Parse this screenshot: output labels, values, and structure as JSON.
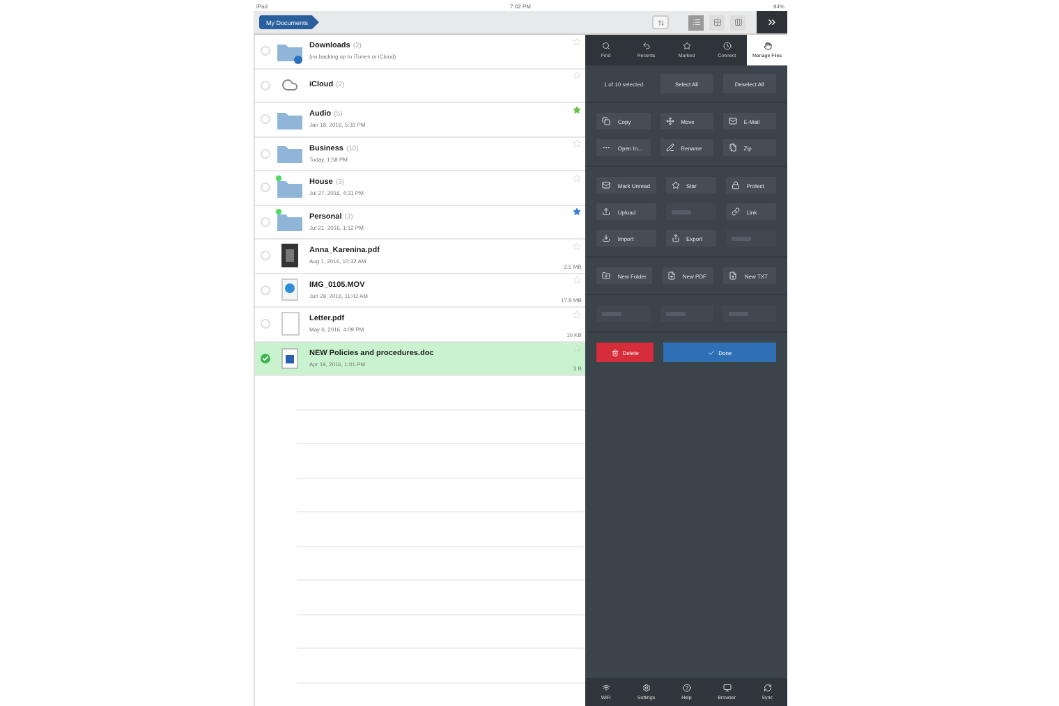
{
  "status_bar": {
    "device": "iPad",
    "time": "7:02 PM",
    "battery": "94%"
  },
  "header": {
    "breadcrumb": "My Documents",
    "views": [
      {
        "kind": "list",
        "selected": true
      },
      {
        "kind": "grid",
        "selected": false
      },
      {
        "kind": "columns",
        "selected": false
      }
    ]
  },
  "files": [
    {
      "kind": "folder",
      "name": "Downloads",
      "count": "(2)",
      "subtitle": "(no backing up to iTunes or iCloud)",
      "badge": true,
      "tagged": false,
      "starred": false,
      "selected": false
    },
    {
      "kind": "cloud",
      "name": "iCloud",
      "count": "(2)",
      "badge": false,
      "tagged": false,
      "starred": false,
      "selected": false
    },
    {
      "kind": "folder",
      "name": "Audio",
      "count": "(5)",
      "subtitle": "Jan 18, 2016, 5:33 PM",
      "badge": false,
      "tagged": false,
      "starred": true,
      "color": "#6cc04a",
      "selected": false
    },
    {
      "kind": "folder",
      "name": "Business",
      "count": "(10)",
      "subtitle": "Today, 1:58 PM",
      "badge": false,
      "tagged": false,
      "starred": false,
      "selected": false
    },
    {
      "kind": "folder",
      "name": "House",
      "count": "(3)",
      "subtitle": "Jul 27, 2016, 4:31 PM",
      "badge": false,
      "tagged": true,
      "starred": false,
      "selected": false
    },
    {
      "kind": "folder",
      "name": "Personal",
      "count": "(3)",
      "subtitle": "Jul 21, 2016, 1:12 PM",
      "badge": false,
      "tagged": true,
      "starred": true,
      "color": "#3b82d6",
      "selected": false
    },
    {
      "kind": "pdf",
      "name": "Anna_Karenina.pdf",
      "subtitle": "Aug 1, 2016, 10:32 AM",
      "size": "2.5 MB",
      "badge": false,
      "tagged": false,
      "starred": false,
      "selected": false
    },
    {
      "kind": "video",
      "name": "IMG_0105.MOV",
      "subtitle": "Jun 29, 2016, 11:42 AM",
      "size": "17.8 MB",
      "badge": false,
      "tagged": false,
      "starred": false,
      "selected": false
    },
    {
      "kind": "blank",
      "name": "Letter.pdf",
      "subtitle": "May 6, 2016, 4:09 PM",
      "size": "10 KB",
      "badge": false,
      "tagged": false,
      "starred": false,
      "selected": false
    },
    {
      "kind": "word",
      "name": "NEW Policies and procedures.doc",
      "subtitle": "Apr 19, 2016, 1:01 PM",
      "size": "3 B",
      "badge": false,
      "tagged": false,
      "starred": false,
      "selected": true
    }
  ],
  "panel": {
    "top_tabs": [
      {
        "label": "Find",
        "selected": false
      },
      {
        "label": "Recents",
        "selected": false
      },
      {
        "label": "Marked",
        "selected": false
      },
      {
        "label": "Connect",
        "selected": false
      },
      {
        "label": "Manage Files",
        "selected": true
      }
    ],
    "selection_count": "1 of 10 selected",
    "select_all": "Select All",
    "deselect_all": "Deselect All",
    "action_groups": [
      [
        {
          "label": "Copy",
          "disabled": false
        },
        {
          "label": "Move",
          "disabled": false
        },
        {
          "label": "E-Mail",
          "disabled": false
        },
        {
          "label": "Open In...",
          "disabled": false
        },
        {
          "label": "Rename",
          "disabled": false
        },
        {
          "label": "Zip",
          "disabled": false
        }
      ],
      [
        {
          "label": "Mark Unread",
          "disabled": false
        },
        {
          "label": "Star",
          "disabled": false
        },
        {
          "label": "Protect",
          "disabled": false
        },
        {
          "label": "Upload",
          "disabled": false
        },
        {
          "disabled": true
        },
        {
          "label": "Link",
          "disabled": false
        },
        {
          "label": "Import",
          "disabled": false
        },
        {
          "label": "Export",
          "disabled": false
        },
        {
          "disabled": true
        }
      ],
      [
        {
          "label": "New Folder",
          "disabled": false
        },
        {
          "label": "New PDF",
          "disabled": false
        },
        {
          "label": "New TXT",
          "disabled": false
        }
      ],
      [
        {
          "disabled": true
        },
        {
          "disabled": true
        },
        {
          "disabled": true
        }
      ]
    ],
    "delete": "Delete",
    "done": "Done",
    "bottom_tabs": [
      {
        "label": "WiFi"
      },
      {
        "label": "Settings"
      },
      {
        "label": "Help"
      },
      {
        "label": "Browser"
      },
      {
        "label": "Sync"
      }
    ]
  }
}
